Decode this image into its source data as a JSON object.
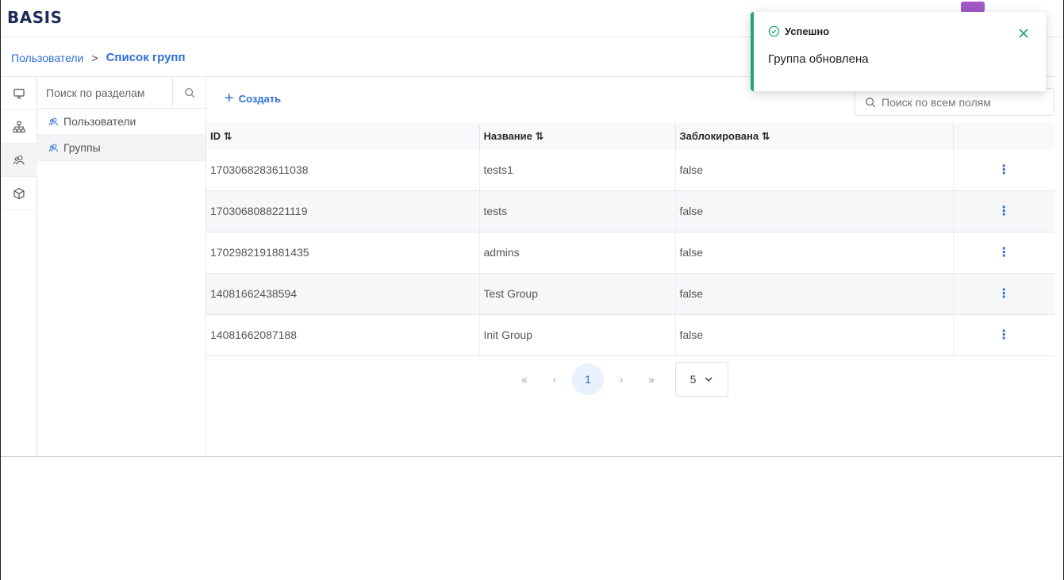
{
  "header": {
    "logo": "BASIS"
  },
  "breadcrumb": {
    "parent": "Пользователи",
    "separator": ">",
    "current": "Список групп"
  },
  "rail": {
    "items": [
      "monitor-icon",
      "hierarchy-icon",
      "users-icon",
      "cube-icon"
    ],
    "active_index": 2
  },
  "sections": {
    "search_placeholder": "Поиск по разделам",
    "items": [
      {
        "label": "Пользователи",
        "icon": "users-icon"
      },
      {
        "label": "Группы",
        "icon": "users-icon",
        "selected": true
      }
    ]
  },
  "toolbar": {
    "create_label": "Создать",
    "search_placeholder": "Поиск по всем полям"
  },
  "table": {
    "columns": [
      "ID ⇅",
      "Название ⇅",
      "Заблокирована ⇅",
      ""
    ],
    "rows": [
      {
        "id": "1703068283611038",
        "name": "tests1",
        "blocked": "false"
      },
      {
        "id": "1703068088221119",
        "name": "tests",
        "blocked": "false"
      },
      {
        "id": "1702982191881435",
        "name": "admins",
        "blocked": "false"
      },
      {
        "id": "14081662438594",
        "name": "Test Group",
        "blocked": "false"
      },
      {
        "id": "14081662087188",
        "name": "Init Group",
        "blocked": "false"
      }
    ]
  },
  "pagination": {
    "first": "«",
    "prev": "‹",
    "page": "1",
    "next": "›",
    "last": "»",
    "page_size": "5"
  },
  "toast": {
    "title": "Успешно",
    "message": "Группа обновлена",
    "status_color": "#1fa66b"
  },
  "colors": {
    "accent": "#2f6fd6",
    "success": "#1fa66b"
  }
}
